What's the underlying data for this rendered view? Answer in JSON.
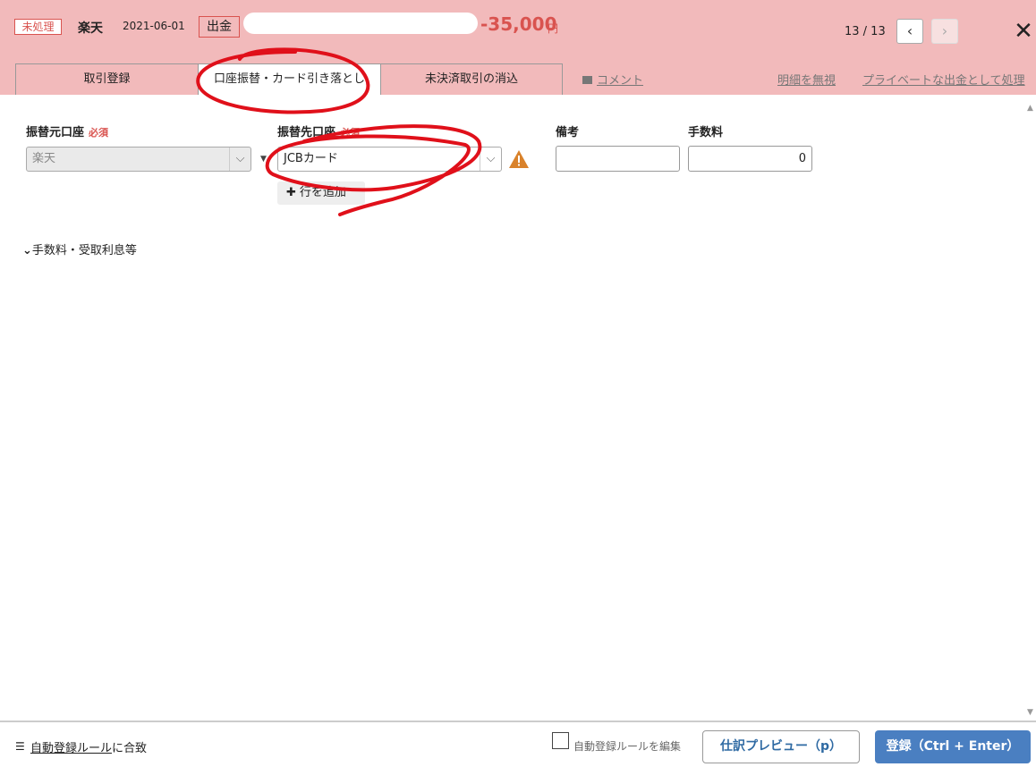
{
  "header": {
    "status_badge": "未処理",
    "bank_name": "楽天",
    "date": "2021-06-01",
    "type_badge": "出金",
    "amount": "-35,000",
    "amount_unit": "円",
    "pager": "13 / 13",
    "prev_icon": "‹",
    "next_icon": "›",
    "close_icon": "✕"
  },
  "tabs": [
    {
      "label": "取引登録"
    },
    {
      "label": "口座振替・カード引き落とし"
    },
    {
      "label": "未決済取引の消込"
    }
  ],
  "links": {
    "comment": "コメント",
    "ignore": "明細を無視",
    "private": "プライベートな出金として処理"
  },
  "form": {
    "source_label": "振替元口座",
    "source_required": "必須",
    "source_value": "楽天",
    "dest_label": "振替先口座",
    "dest_required": "必須",
    "dest_value": "JCBカード",
    "memo_label": "備考",
    "memo_value": "",
    "fee_label": "手数料",
    "fee_value": "0",
    "add_row": "行を追加",
    "expander": "手数料・受取利息等"
  },
  "footer": {
    "rule_link": "自動登録ルール",
    "rule_suffix": "に合致",
    "rule_checkbox_label": "自動登録ルールを編集",
    "preview_button": "仕訳プレビュー（p）",
    "submit_button": "登録（Ctrl + Enter）"
  },
  "colors": {
    "header_bg": "#f2babb",
    "accent_red": "#d9534f",
    "primary_blue": "#4a7fc1",
    "annotation_red": "#e0101a"
  }
}
